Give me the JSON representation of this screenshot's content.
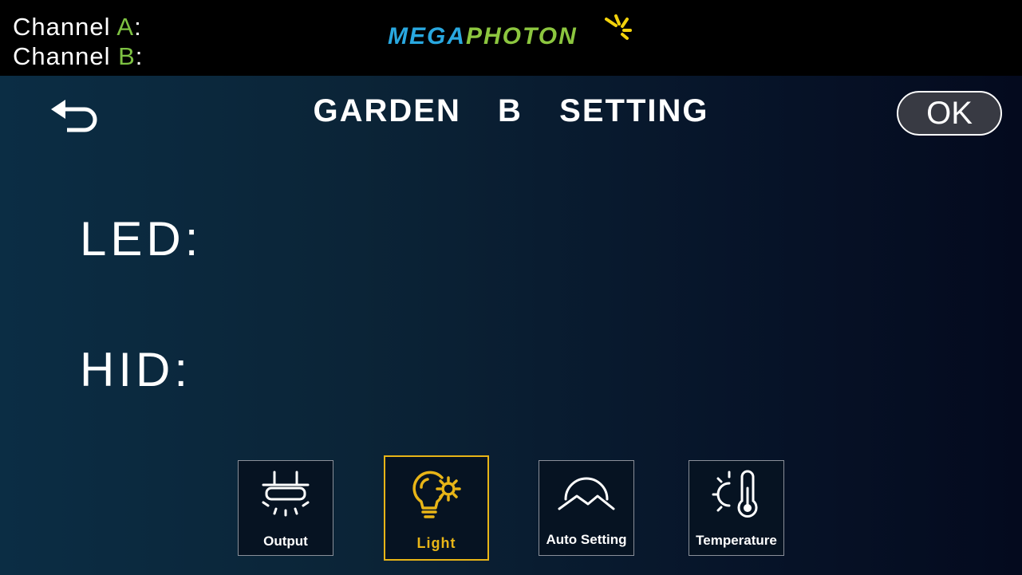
{
  "header": {
    "channel_a": {
      "prefix": "Channel ",
      "letter": "A",
      "suffix": ":"
    },
    "channel_b": {
      "prefix": "Channel ",
      "letter": "B",
      "suffix": ":"
    },
    "logo_mega": "MEGA",
    "logo_photon": "PHOTON",
    "logo_icon": "sun-rays-icon"
  },
  "screen": {
    "title": "GARDEN  B  SETTING",
    "ok_label": "OK",
    "back_icon": "back-arrow-icon"
  },
  "fields": {
    "led_label": "LED:",
    "hid_label": "HID:"
  },
  "tabs": [
    {
      "label": "Output",
      "icon": "lamp-fixture-icon",
      "active": false
    },
    {
      "label": "Light",
      "icon": "bulb-gear-icon",
      "active": true
    },
    {
      "label": "Auto Setting",
      "icon": "sunrise-mountain-icon",
      "active": false
    },
    {
      "label": "Temperature",
      "icon": "sun-thermometer-icon",
      "active": false
    }
  ],
  "colors": {
    "accent_green": "#7dc142",
    "active_tab": "#e8b517",
    "logo_blue": "#29a8e0",
    "logo_green": "#8cc63f"
  }
}
